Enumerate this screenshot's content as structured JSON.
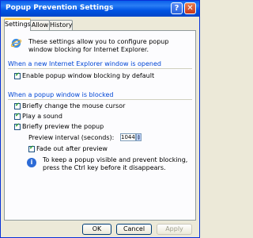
{
  "window": {
    "title": "Popup Prevention Settings"
  },
  "titlebar": {
    "help_glyph": "?",
    "close_glyph": "✕"
  },
  "tabs": [
    {
      "label": "Settings"
    },
    {
      "label": "Allow"
    },
    {
      "label": "History"
    }
  ],
  "settings": {
    "intro_text": "These settings allow you to configure popup window blocking for Internet Explorer.",
    "group_new_window": {
      "title": "When a new Internet Explorer window is opened",
      "enable_label": "Enable popup window blocking by default",
      "enable_checked": true
    },
    "group_blocked": {
      "title": "When a popup window is blocked",
      "options": [
        {
          "label": "Briefly change the mouse cursor",
          "checked": true
        },
        {
          "label": "Play a sound",
          "checked": true
        },
        {
          "label": "Briefly preview the popup",
          "checked": true
        }
      ],
      "preview_interval_label": "Preview interval (seconds):",
      "preview_interval_value": "1044",
      "fade_label": "Fade out after preview",
      "fade_checked": true,
      "info_text": "To keep a popup visible and prevent blocking, press the Ctrl key before it disappears."
    }
  },
  "buttons": {
    "ok": "OK",
    "cancel": "Cancel",
    "apply": "Apply"
  }
}
